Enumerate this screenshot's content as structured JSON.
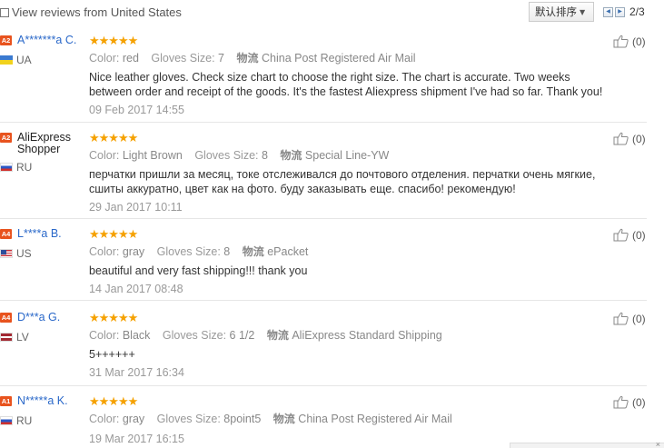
{
  "toolbar": {
    "filter_label": "View reviews from United States",
    "sort_label": "默认排序",
    "page_text": "2/3",
    "prev_icon": "chevron-left",
    "next_icon": "chevron-right"
  },
  "reviews": [
    {
      "level": "A2",
      "user": "A*******a C.",
      "country": "UA",
      "color_key": "Color:",
      "color": "red",
      "size_key": "Gloves Size:",
      "size": "7",
      "ship_key": "物流",
      "ship": "China Post Registered Air Mail",
      "text": "Nice leather gloves. Check size chart to choose the right size. The chart is accurate. Two weeks between order and receipt of the goods. It's the fastest Aliexpress shipment I've had so far. Thank you!",
      "date": "09 Feb 2017 14:55",
      "helpful": "(0)",
      "stars": "★★★★★"
    },
    {
      "level": "A2",
      "user": "AliExpress Shopper",
      "country": "RU",
      "color_key": "Color:",
      "color": "Light Brown",
      "size_key": "Gloves Size:",
      "size": "8",
      "ship_key": "物流",
      "ship": "Special Line-YW",
      "text": "перчатки пришли за месяц, токе отслеживался до почтового отделения. перчатки очень мягкие, сшиты аккуратно, цвет как на фото. буду заказывать еще. спасибо! рекомендую!",
      "date": "29 Jan 2017 10:11",
      "helpful": "(0)",
      "stars": "★★★★★"
    },
    {
      "level": "A4",
      "user": "L****a B.",
      "country": "US",
      "color_key": "Color:",
      "color": "gray",
      "size_key": "Gloves Size:",
      "size": "8",
      "ship_key": "物流",
      "ship": "ePacket",
      "text": "beautiful and very fast shipping!!! thank you",
      "date": "14 Jan 2017 08:48",
      "helpful": "(0)",
      "stars": "★★★★★"
    },
    {
      "level": "A4",
      "user": "D***a G.",
      "country": "LV",
      "color_key": "Color:",
      "color": "Black",
      "size_key": "Gloves Size:",
      "size": "6 1/2",
      "ship_key": "物流",
      "ship": "AliExpress Standard Shipping",
      "text": "5++++++",
      "date": "31 Mar 2017 16:34",
      "helpful": "(0)",
      "stars": "★★★★★"
    },
    {
      "level": "A1",
      "user": "N*****a K.",
      "country": "RU",
      "color_key": "Color:",
      "color": "gray",
      "size_key": "Gloves Size:",
      "size": "8point5",
      "ship_key": "物流",
      "ship": "China Post Registered Air Mail",
      "text": "",
      "date": "19 Mar 2017 16:15",
      "helpful": "(0)",
      "stars": "★★★★★"
    }
  ]
}
